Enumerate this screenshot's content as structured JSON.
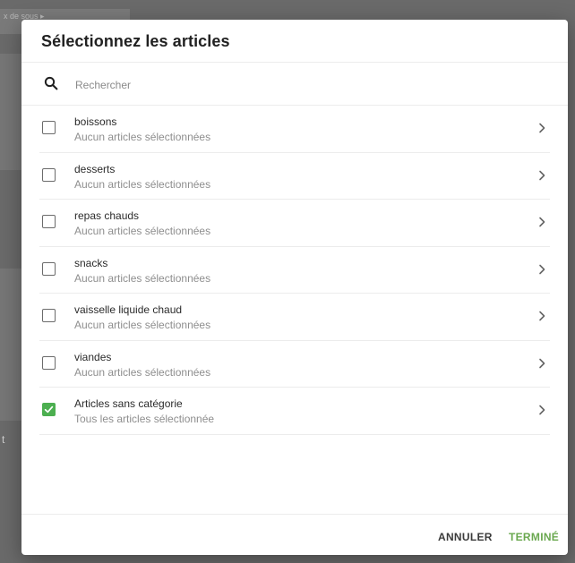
{
  "background": {
    "tab_text": "x de sous ▸",
    "side_glyph": "t"
  },
  "dialog": {
    "title": "Sélectionnez les articles",
    "search": {
      "placeholder": "Rechercher",
      "value": ""
    },
    "items": [
      {
        "label": "boissons",
        "status": "Aucun articles sélectionnées",
        "checked": false
      },
      {
        "label": "desserts",
        "status": "Aucun articles sélectionnées",
        "checked": false
      },
      {
        "label": "repas chauds",
        "status": "Aucun articles sélectionnées",
        "checked": false
      },
      {
        "label": "snacks",
        "status": "Aucun articles sélectionnées",
        "checked": false
      },
      {
        "label": "vaisselle liquide chaud",
        "status": "Aucun articles sélectionnées",
        "checked": false
      },
      {
        "label": "viandes",
        "status": "Aucun articles sélectionnées",
        "checked": false
      },
      {
        "label": "Articles sans catégorie",
        "status": "Tous les articles sélectionnée",
        "checked": true
      }
    ],
    "buttons": {
      "cancel": "ANNULER",
      "done": "TERMINÉ"
    }
  },
  "colors": {
    "accent": "#4caf50",
    "done_text": "#6aa84f",
    "overlay": "#6a6a6a"
  },
  "icons": {
    "search": "search-icon",
    "chevron": "chevron-right-icon",
    "check": "check-icon"
  }
}
